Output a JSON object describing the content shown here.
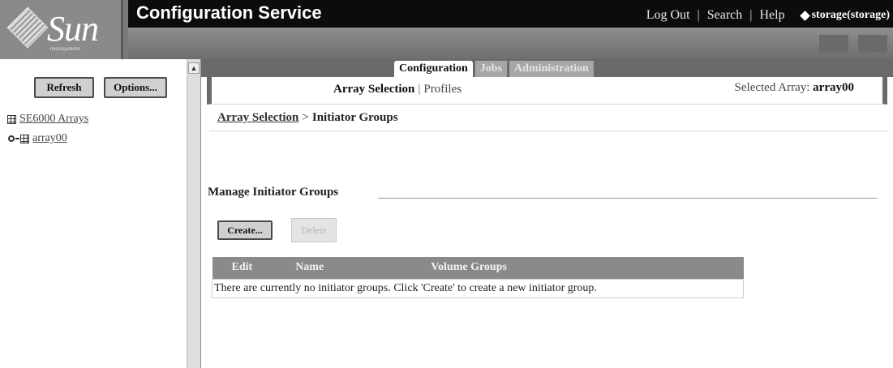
{
  "branding": {
    "logo_text": "Sun",
    "logo_subtext": "microsystems",
    "app_title": "Configuration Service"
  },
  "header": {
    "links": [
      "Log Out",
      "Search",
      "Help"
    ],
    "user": "storage(storage)"
  },
  "nav": {
    "refresh_label": "Refresh",
    "options_label": "Options...",
    "tree": [
      {
        "label": "SE6000 Arrays"
      },
      {
        "label": "array00"
      }
    ]
  },
  "main": {
    "tabs": [
      {
        "label": "Configuration",
        "active": true
      },
      {
        "label": "Jobs",
        "active": false
      },
      {
        "label": "Administration",
        "active": false
      }
    ],
    "subtabs": {
      "array_selection": "Array Selection",
      "separator": "|",
      "profiles": "Profiles"
    },
    "selected_array": {
      "label": "Selected Array:",
      "value": "array00"
    },
    "breadcrumb": {
      "link": "Array Selection",
      "separator": ">",
      "current": "Initiator Groups"
    },
    "section_title": "Manage Initiator Groups",
    "buttons": {
      "create": "Create...",
      "delete": "Delete"
    },
    "table": {
      "columns": [
        "Edit",
        "Name",
        "Volume Groups"
      ],
      "empty_message": "There are currently no initiator groups. Click 'Create' to create a new initiator group."
    }
  },
  "colors": {
    "banner": "#7a7a7a",
    "title_bar": "#0c0c0c",
    "tab_band": "#6a6a6a",
    "table_header": "#8a8a8a"
  }
}
